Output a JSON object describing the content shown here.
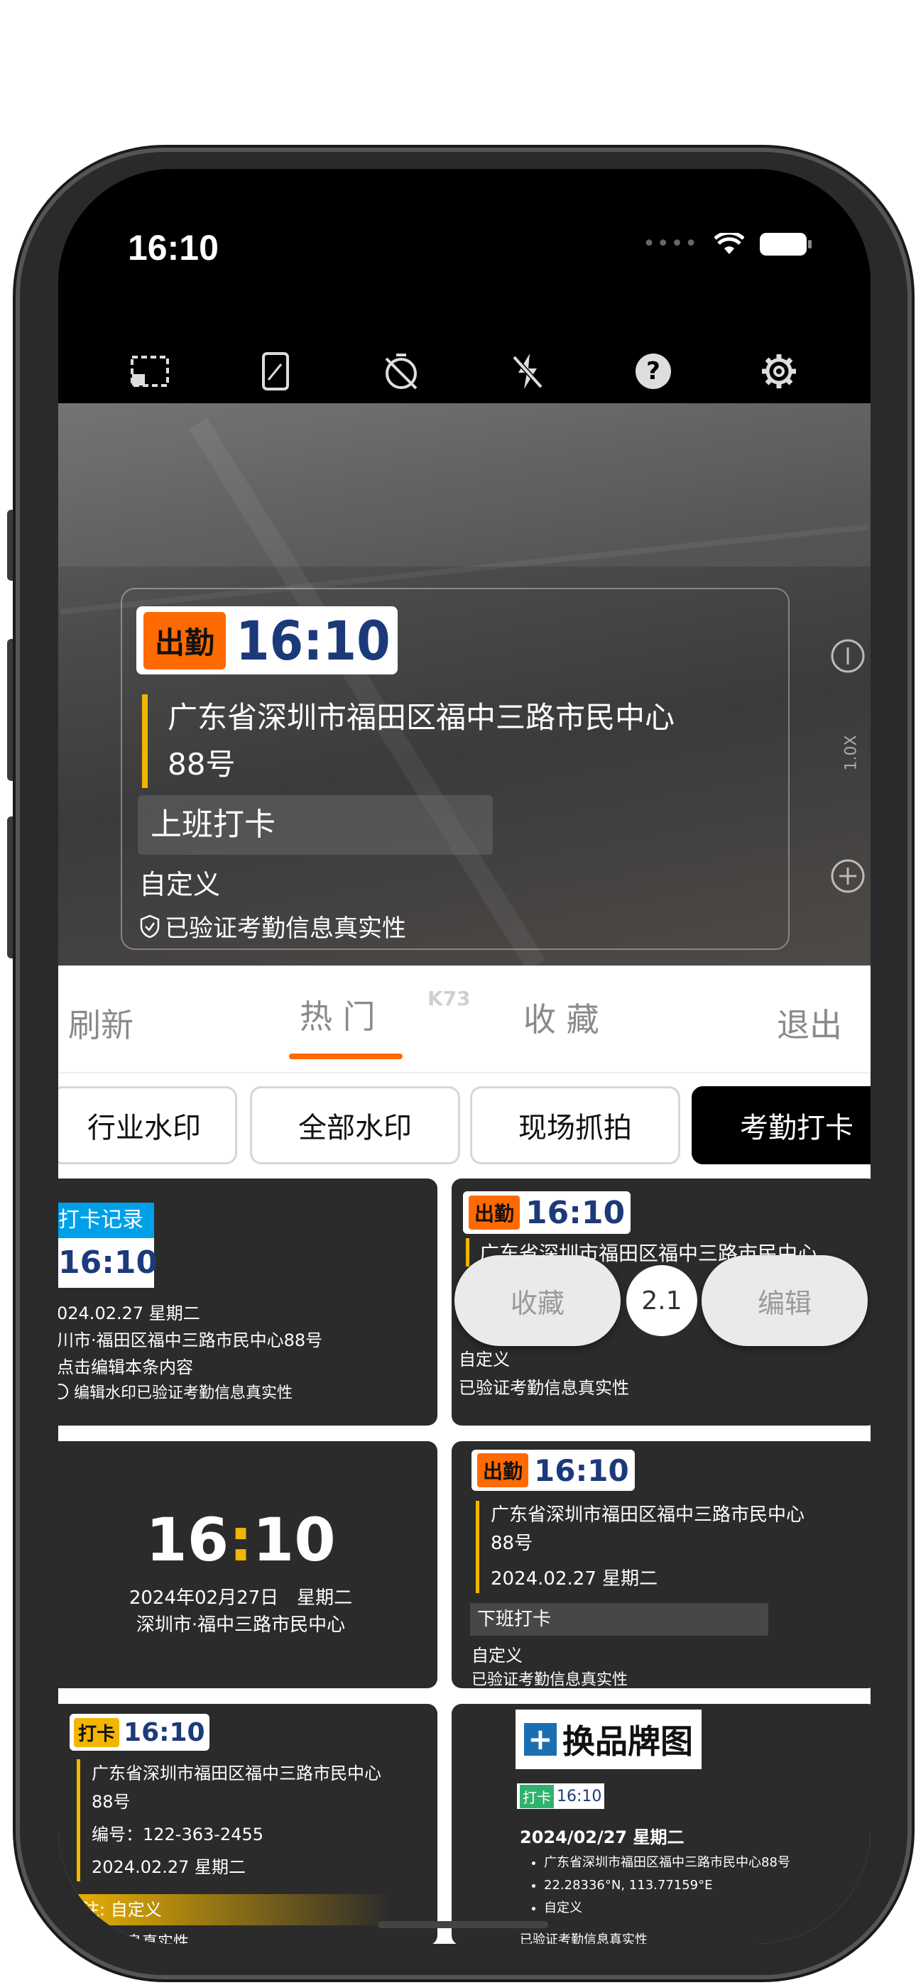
{
  "status": {
    "time": "16:10"
  },
  "toolbar": {
    "icons": [
      "frame-icon",
      "phone-screen-icon",
      "timer-off-icon",
      "flash-off-icon",
      "help-icon",
      "settings-icon"
    ]
  },
  "preview": {
    "tag": "出勤",
    "time": "16:10",
    "address_line1": "广东省深圳市福田区福中三路市民中心",
    "address_line2": "88号",
    "punch": "上班打卡",
    "custom": "自定义",
    "verify": "已验证考勤信息真实性",
    "zoom": "1.0X"
  },
  "tabs": {
    "refresh": "刷新",
    "hot": "热 门",
    "favorites": "收 藏",
    "exit": "退出"
  },
  "chips": [
    "行业水印",
    "全部水印",
    "现场抓拍",
    "考勤打卡"
  ],
  "cards": {
    "c1": {
      "badge": "打卡记录",
      "time": "16:10",
      "date": "024.02.27 星期二",
      "addr": "川市·福田区福中三路市民中心88号",
      "edit": "点击编辑本条内容",
      "verify": "编辑水印已验证考勤信息真实性"
    },
    "c2": {
      "tag": "出勤",
      "time": "16:10",
      "addr": "广东省深圳市福田区福中三路市民中心",
      "custom": "自定义",
      "verify": "已验证考勤信息真实性",
      "collect": "收藏",
      "version": "2.1",
      "edit": "编辑"
    },
    "c3": {
      "time_h": "16",
      "colon": ":",
      "time_m": "10",
      "date": "2024年02月27日　星期二",
      "addr": "深圳市·福中三路市民中心"
    },
    "c4": {
      "tag": "出勤",
      "time": "16:10",
      "addr1": "广东省深圳市福田区福中三路市民中心",
      "addr2": "88号",
      "date": "2024.02.27 星期二",
      "punch": "下班打卡",
      "custom": "自定义",
      "verify": "已验证考勤信息真实性"
    },
    "c5": {
      "tag": "打卡",
      "time": "16:10",
      "addr1": "广东省深圳市福田区福中三路市民中心",
      "addr2": "88号",
      "code": "编号：122-363-2455",
      "date": "2024.02.27 星期二",
      "note": "备注: 自定义",
      "verify": "考勤信息真实性"
    },
    "c6": {
      "brand": "换品牌图",
      "tag": "打卡",
      "time": "16:10",
      "date": "2024/02/27 星期二",
      "bullet1": "广东省深圳市福田区福中三路市民中心88号",
      "bullet2": "22.28336°N, 113.77159°E",
      "bullet3": "自定义",
      "verify": "已验证考勤信息真实性"
    }
  },
  "colors": {
    "accent_orange": "#ff6a00",
    "accent_yellow": "#f2b600",
    "card_bg": "#2b2b2b",
    "blue_badge": "#00a0e9",
    "navy_time": "#1c3a7a"
  }
}
